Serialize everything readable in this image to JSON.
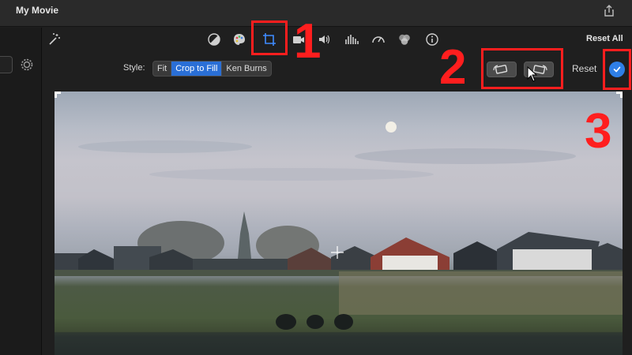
{
  "window": {
    "title": "My Movie"
  },
  "toolbar": {
    "tools": [
      {
        "name": "magic-wand-icon"
      },
      {
        "name": "color-balance-icon"
      },
      {
        "name": "color-correction-icon"
      },
      {
        "name": "crop-icon",
        "selected": true
      },
      {
        "name": "stabilization-icon"
      },
      {
        "name": "volume-icon"
      },
      {
        "name": "noise-reduction-icon"
      },
      {
        "name": "speed-icon"
      },
      {
        "name": "clip-filter-icon"
      },
      {
        "name": "info-icon"
      }
    ],
    "reset_all_label": "Reset All"
  },
  "crop_bar": {
    "style_label": "Style:",
    "styles": [
      {
        "label": "Fit",
        "active": false
      },
      {
        "label": "Crop to Fill",
        "active": true
      },
      {
        "label": "Ken Burns",
        "active": false
      }
    ],
    "rotate_left": "rotate-left-icon",
    "rotate_right": "rotate-right-icon",
    "reset_label": "Reset",
    "apply": "checkmark-icon"
  },
  "annotations": [
    {
      "number": "1"
    },
    {
      "number": "2"
    },
    {
      "number": "3"
    }
  ],
  "colors": {
    "accent": "#2a6fd6",
    "apply": "#2f7fe6",
    "annotation": "#ff1e1e",
    "background": "#1f1f1f"
  }
}
